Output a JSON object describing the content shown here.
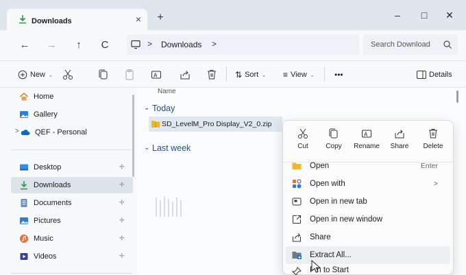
{
  "window": {
    "tab_title": "Downloads",
    "tab_close": "×",
    "new_tab": "+",
    "minimize": "–",
    "maximize": "□",
    "close": "✕"
  },
  "nav": {
    "back": "←",
    "forward": "→",
    "up": "↑",
    "refresh": "C",
    "address_chevron": ">",
    "address": "Downloads",
    "search_placeholder": "Search Download"
  },
  "toolbar": {
    "new_label": "New",
    "sort_label": "Sort",
    "view_label": "View",
    "more_label": "•••",
    "details_label": "Details"
  },
  "sidebar": {
    "items_top": [
      {
        "label": "Home",
        "icon": "home-icon"
      },
      {
        "label": "Gallery",
        "icon": "gallery-icon"
      },
      {
        "label": "QEF - Personal",
        "icon": "cloud-icon"
      }
    ],
    "items_pinned": [
      {
        "label": "Desktop",
        "icon": "desktop-icon"
      },
      {
        "label": "Downloads",
        "icon": "download-icon",
        "selected": true
      },
      {
        "label": "Documents",
        "icon": "documents-icon"
      },
      {
        "label": "Pictures",
        "icon": "pictures-icon"
      },
      {
        "label": "Music",
        "icon": "music-icon"
      },
      {
        "label": "Videos",
        "icon": "videos-icon"
      }
    ]
  },
  "main": {
    "column_name": "Name",
    "group_today": "Today",
    "group_last_week": "Last week",
    "file": "SD_LevelM_Pro Display_V2_0.zip"
  },
  "context_menu": {
    "quick_actions": [
      "Cut",
      "Copy",
      "Rename",
      "Share",
      "Delete"
    ],
    "items": [
      {
        "label": "Open",
        "shortcut": "Enter"
      },
      {
        "label": "Open with",
        "shortcut": ">"
      },
      {
        "label": "Open in new tab",
        "shortcut": ""
      },
      {
        "label": "Open in new window",
        "shortcut": ""
      },
      {
        "label": "Share",
        "shortcut": ""
      },
      {
        "label": "Extract All...",
        "shortcut": ""
      },
      {
        "label": "Pin to Start",
        "shortcut": ""
      }
    ]
  },
  "colors": {
    "accent": "#1f6fc1",
    "folder": "#f3b62a",
    "download": "#1e9b4d"
  }
}
